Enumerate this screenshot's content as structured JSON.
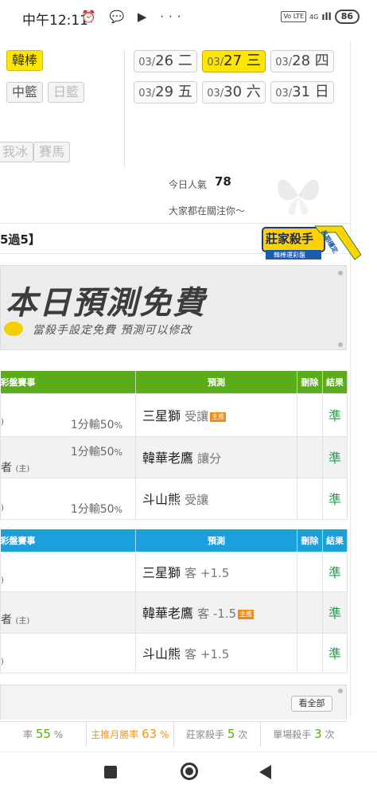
{
  "status_bar": {
    "time": "中午12:11",
    "left_icons": "⏰ 💬 ▶ ···",
    "volte": "Vo LTE",
    "network": "4G",
    "signal": "ıll",
    "battery": "86"
  },
  "sport_tags": [
    {
      "label": "韓棒",
      "active": true
    },
    {
      "label": "中籃",
      "active": false
    },
    {
      "label": "日籃",
      "disabled": true
    },
    {
      "label": "我冰",
      "disabled": true
    },
    {
      "label": "賽馬",
      "disabled": true
    }
  ],
  "dates": [
    {
      "date": "03/",
      "day": "26",
      "weekday": "二",
      "active": false
    },
    {
      "date": "03/",
      "day": "27",
      "weekday": "三",
      "active": true
    },
    {
      "date": "03/",
      "day": "28",
      "weekday": "四",
      "active": false
    },
    {
      "date": "03/",
      "day": "29",
      "weekday": "五",
      "active": false
    },
    {
      "date": "03/",
      "day": "30",
      "weekday": "六",
      "active": false
    },
    {
      "date": "03/",
      "day": "31",
      "weekday": "日",
      "active": false
    }
  ],
  "popularity": {
    "label": "今日人氣",
    "value": "78",
    "note": "大家都在關注你～"
  },
  "section_title": "5過5】",
  "badge": {
    "title": "莊家殺手",
    "subtitle": "韓棒運彩盤",
    "ribbon": "長期穩定"
  },
  "banner": {
    "title": "本日預測免費",
    "subtitle": "當殺手設定免費  預測可以修改"
  },
  "table1": {
    "headers": [
      "彩盤賽事",
      "預測",
      "刪除",
      "結果"
    ],
    "rows": [
      {
        "event_left": ")",
        "event_right": "1分輸50",
        "pct": "%",
        "team": "三星獅",
        "note": "受讓",
        "main": "主推",
        "result": "準"
      },
      {
        "event_left": "者",
        "owner": "(主)",
        "event_right": "1分輸50",
        "pct": "%",
        "team": "韓華老鷹",
        "note": "讓分",
        "main": "",
        "result": "準"
      },
      {
        "event_left": ")",
        "event_right": "1分輸50",
        "pct": "%",
        "team": "斗山熊",
        "note": "受讓",
        "main": "",
        "result": "準"
      }
    ]
  },
  "table2": {
    "headers": [
      "彩盤賽事",
      "預測",
      "刪除",
      "結果"
    ],
    "rows": [
      {
        "event_left": ")",
        "team": "三星獅",
        "note": "客 +1.5",
        "main": "",
        "result": "準"
      },
      {
        "event_left": "者",
        "owner": "(主)",
        "team": "韓華老鷹",
        "note": "客 -1.5",
        "main": "主推",
        "result": "準"
      },
      {
        "event_left": ")",
        "team": "斗山熊",
        "note": "客 +1.5",
        "main": "",
        "result": "準"
      }
    ]
  },
  "view_all": "看全部",
  "stats": [
    {
      "label": "率",
      "value": "55",
      "unit": "%",
      "color": "green"
    },
    {
      "label": "主推月勝率",
      "value": "63",
      "unit": "%",
      "color": "orange"
    },
    {
      "label": "莊家殺手",
      "value": "5",
      "unit": "次",
      "color": "green"
    },
    {
      "label": "單場殺手",
      "value": "3",
      "unit": "次",
      "color": "green"
    }
  ],
  "colors": {
    "accent_yellow": "#ffe600",
    "header_green": "#5aac1a",
    "header_blue": "#1aa0dc",
    "result_green": "#1aa44a",
    "main_orange": "#f08a1a"
  }
}
